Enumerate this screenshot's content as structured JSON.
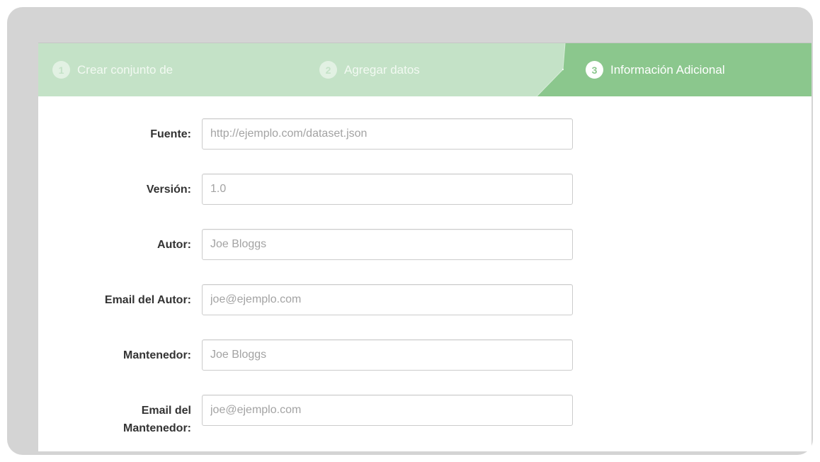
{
  "stages": [
    {
      "number": "1",
      "label": "Crear conjunto de",
      "state": "complete"
    },
    {
      "number": "2",
      "label": "Agregar datos",
      "state": "complete"
    },
    {
      "number": "3",
      "label": "Información Adicional",
      "state": "active"
    }
  ],
  "form": {
    "fields": [
      {
        "label": "Fuente:",
        "placeholder": "http://ejemplo.com/dataset.json",
        "value": ""
      },
      {
        "label": "Versión:",
        "placeholder": "1.0",
        "value": ""
      },
      {
        "label": "Autor:",
        "placeholder": "Joe Bloggs",
        "value": ""
      },
      {
        "label": "Email del Autor:",
        "placeholder": "joe@ejemplo.com",
        "value": ""
      },
      {
        "label": "Mantenedor:",
        "placeholder": "Joe Bloggs",
        "value": ""
      },
      {
        "label_line1": "Email del",
        "label_line2": "Mantenedor:",
        "placeholder": "joe@ejemplo.com",
        "value": ""
      }
    ]
  },
  "colors": {
    "stage_complete_bg": "#c4e2c7",
    "stage_active_bg": "#8bc78d",
    "frame_bg": "#d4d4d4",
    "label_text": "#333333",
    "input_border": "#cccccc",
    "placeholder_text": "#a3a3a3"
  }
}
